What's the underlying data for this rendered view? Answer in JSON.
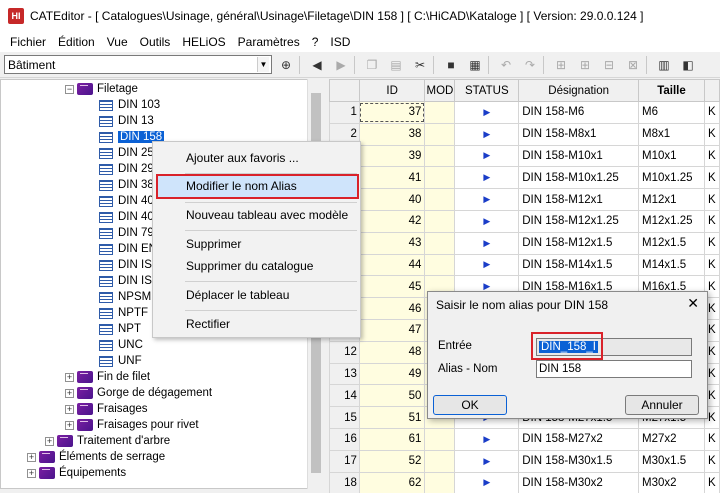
{
  "window": {
    "app_icon_text": "HI",
    "title": "CATEditor - [ Catalogues\\Usinage, général\\Usinage\\Filetage\\DIN 158 ]      [ C:\\HiCAD\\Kataloge ]   [ Version: 29.0.0.124 ]"
  },
  "menubar": [
    "Fichier",
    "Édition",
    "Vue",
    "Outils",
    "HELiOS",
    "Paramètres",
    "?",
    "ISD"
  ],
  "toolbar": {
    "combo_value": "Bâtiment",
    "icons": [
      "binoculars-icon",
      "back-icon",
      "forward-icon",
      "copy-icon",
      "paste-icon",
      "cut-icon",
      "save-icon",
      "table-icon",
      "undo-icon",
      "redo-icon",
      "insert-row-icon",
      "insert-row-below-icon",
      "delete-row-icon",
      "move-row-icon",
      "table-settings-icon",
      "clear-icon"
    ]
  },
  "tree": {
    "filetage": "Filetage",
    "leaves": [
      "DIN 103",
      "DIN 13",
      "DIN 158",
      "DIN 25",
      "DIN 29",
      "DIN 38",
      "DIN 40",
      "DIN 40",
      "DIN 79",
      "DIN EN",
      "DIN ISO",
      "DIN ISO",
      "NPSM",
      "NPTF",
      "NPT",
      "UNC",
      "UNF"
    ],
    "selected_index": 2,
    "siblings": [
      "Fin de filet",
      "Gorge de dégagement",
      "Fraisages",
      "Fraisages pour rivet"
    ],
    "traitement": "Traitement d'arbre",
    "top_level": [
      "Éléments de serrage",
      "Équipements"
    ]
  },
  "table": {
    "headers": [
      "ID",
      "MOD",
      "STATUS",
      "Désignation",
      "Taille"
    ],
    "rows": [
      {
        "n": "1",
        "id": "37",
        "des": "DIN 158-M6",
        "taille": "M6",
        "k": "K"
      },
      {
        "n": "2",
        "id": "38",
        "des": "DIN 158-M8x1",
        "taille": "M8x1",
        "k": "K"
      },
      {
        "n": "3",
        "id": "39",
        "des": "DIN 158-M10x1",
        "taille": "M10x1",
        "k": "K"
      },
      {
        "n": "4",
        "id": "41",
        "des": "DIN 158-M10x1.25",
        "taille": "M10x1.25",
        "k": "K"
      },
      {
        "n": "5",
        "id": "40",
        "des": "DIN 158-M12x1",
        "taille": "M12x1",
        "k": "K"
      },
      {
        "n": "6",
        "id": "42",
        "des": "DIN 158-M12x1.25",
        "taille": "M12x1.25",
        "k": "K"
      },
      {
        "n": "7",
        "id": "43",
        "des": "DIN 158-M12x1.5",
        "taille": "M12x1.5",
        "k": "K"
      },
      {
        "n": "8",
        "id": "44",
        "des": "DIN 158-M14x1.5",
        "taille": "M14x1.5",
        "k": "K"
      },
      {
        "n": "9",
        "id": "45",
        "des": "DIN 158-M16x1.5",
        "taille": "M16x1.5",
        "k": "K"
      },
      {
        "n": "10",
        "id": "46",
        "des": "",
        "taille": "",
        "k": "K"
      },
      {
        "n": "11",
        "id": "47",
        "des": "",
        "taille": "",
        "k": "K"
      },
      {
        "n": "12",
        "id": "48",
        "des": "",
        "taille": "",
        "k": "K"
      },
      {
        "n": "13",
        "id": "49",
        "des": "",
        "taille": "",
        "k": "K"
      },
      {
        "n": "14",
        "id": "50",
        "des": "",
        "taille": "",
        "k": "K"
      },
      {
        "n": "15",
        "id": "51",
        "des": "DIN 158-M27x1.5",
        "taille": "M27x1.5",
        "k": "K"
      },
      {
        "n": "16",
        "id": "61",
        "des": "DIN 158-M27x2",
        "taille": "M27x2",
        "k": "K"
      },
      {
        "n": "17",
        "id": "52",
        "des": "DIN 158-M30x1.5",
        "taille": "M30x1.5",
        "k": "K"
      },
      {
        "n": "18",
        "id": "62",
        "des": "DIN 158-M30x2",
        "taille": "M30x2",
        "k": "K"
      }
    ]
  },
  "context_menu": {
    "items": [
      "Ajouter aux favoris ...",
      "Modifier le nom Alias",
      "Nouveau tableau avec modèle",
      "Supprimer",
      "Supprimer du catalogue",
      "Déplacer le tableau",
      "Rectifier"
    ],
    "highlight_color": "#d9222a"
  },
  "dialog": {
    "title": "Saisir le nom alias pour DIN 158",
    "close": "✕",
    "entree_label": "Entrée",
    "entree_value": "DIN_158_I",
    "alias_label": "Alias - Nom",
    "alias_value": "DIN 158",
    "ok": "OK",
    "cancel": "Annuler"
  }
}
